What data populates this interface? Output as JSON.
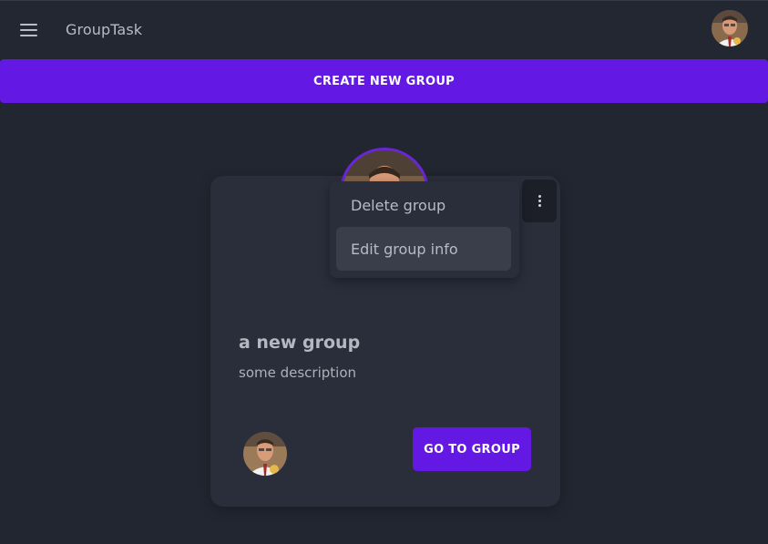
{
  "header": {
    "app_title": "GroupTask",
    "menu_icon": "hamburger-menu-icon",
    "user_avatar": "user-avatar"
  },
  "actions": {
    "create_group_label": "CREATE NEW GROUP"
  },
  "group_card": {
    "name": "a new group",
    "description": "some description",
    "goto_label": "GO TO GROUP",
    "options_icon": "more-vertical-icon"
  },
  "options_menu": {
    "items": [
      {
        "label": "Delete group"
      },
      {
        "label": "Edit group info"
      }
    ]
  },
  "colors": {
    "background": "#222631",
    "card": "#2a2e3b",
    "accent": "#6418e4",
    "avatar_ring": "#6b25d9"
  }
}
